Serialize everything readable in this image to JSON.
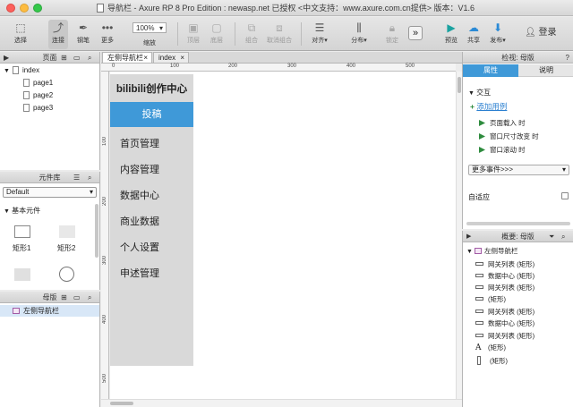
{
  "window": {
    "title": "导航栏 - Axure RP 8 Pro Edition : newasp.net 已授权    <中文支持：www.axure.com.cn提供> 版本：V1.6"
  },
  "toolbar": {
    "select": "选择",
    "connect": "连接",
    "pen": "钢笔",
    "more": "更多",
    "zoom_value": "100%",
    "zoom": "缩放",
    "top": "顶层",
    "bottom": "底层",
    "group": "组合",
    "ungroup": "取消组合",
    "align": "对齐",
    "distribute": "分布",
    "lock": "锁定",
    "preview": "预览",
    "share": "共享",
    "publish": "发布",
    "login": "登录"
  },
  "pages_panel": {
    "title": "页面",
    "root": "index",
    "pages": [
      "page1",
      "page2",
      "page3"
    ]
  },
  "library_panel": {
    "title": "元件库",
    "select_value": "Default",
    "section": "基本元件",
    "widgets": [
      "矩形1",
      "矩形2"
    ]
  },
  "masters_panel": {
    "title": "母版",
    "items": [
      "左侧导航栏"
    ]
  },
  "canvas": {
    "tabs": [
      "左侧导航栏",
      "index"
    ],
    "ruler_h": [
      "0",
      "100",
      "200",
      "300",
      "400",
      "500"
    ],
    "ruler_v": [
      "100",
      "200",
      "300",
      "400",
      "500"
    ]
  },
  "sidebar_nav": {
    "title": "bilibili创作中心",
    "button": "投稿",
    "items": [
      "首页管理",
      "内容管理",
      "数据中心",
      "商业数据",
      "个人设置",
      "申述管理"
    ],
    "button_color": "#3f99d8",
    "bg_color": "#d9d9d9"
  },
  "inspector": {
    "header": "检视: 母版",
    "tabs": [
      "属性",
      "说明"
    ],
    "interaction": "交互",
    "add_case": "添加用例",
    "events": [
      "页面载入 时",
      "窗口尺寸改变 时",
      "窗口滚动 时"
    ],
    "more_events": "更多事件>>>",
    "adaptive": "自适应"
  },
  "outline": {
    "header": "概要: 母版",
    "root": "左侧导航栏",
    "items": [
      "网关列表 (矩形)",
      "数据中心 (矩形)",
      "网关列表 (矩形)",
      "(矩形)",
      "网关列表 (矩形)",
      "数据中心 (矩形)",
      "网关列表 (矩形)",
      "(矩形)",
      "(矩形)"
    ]
  }
}
